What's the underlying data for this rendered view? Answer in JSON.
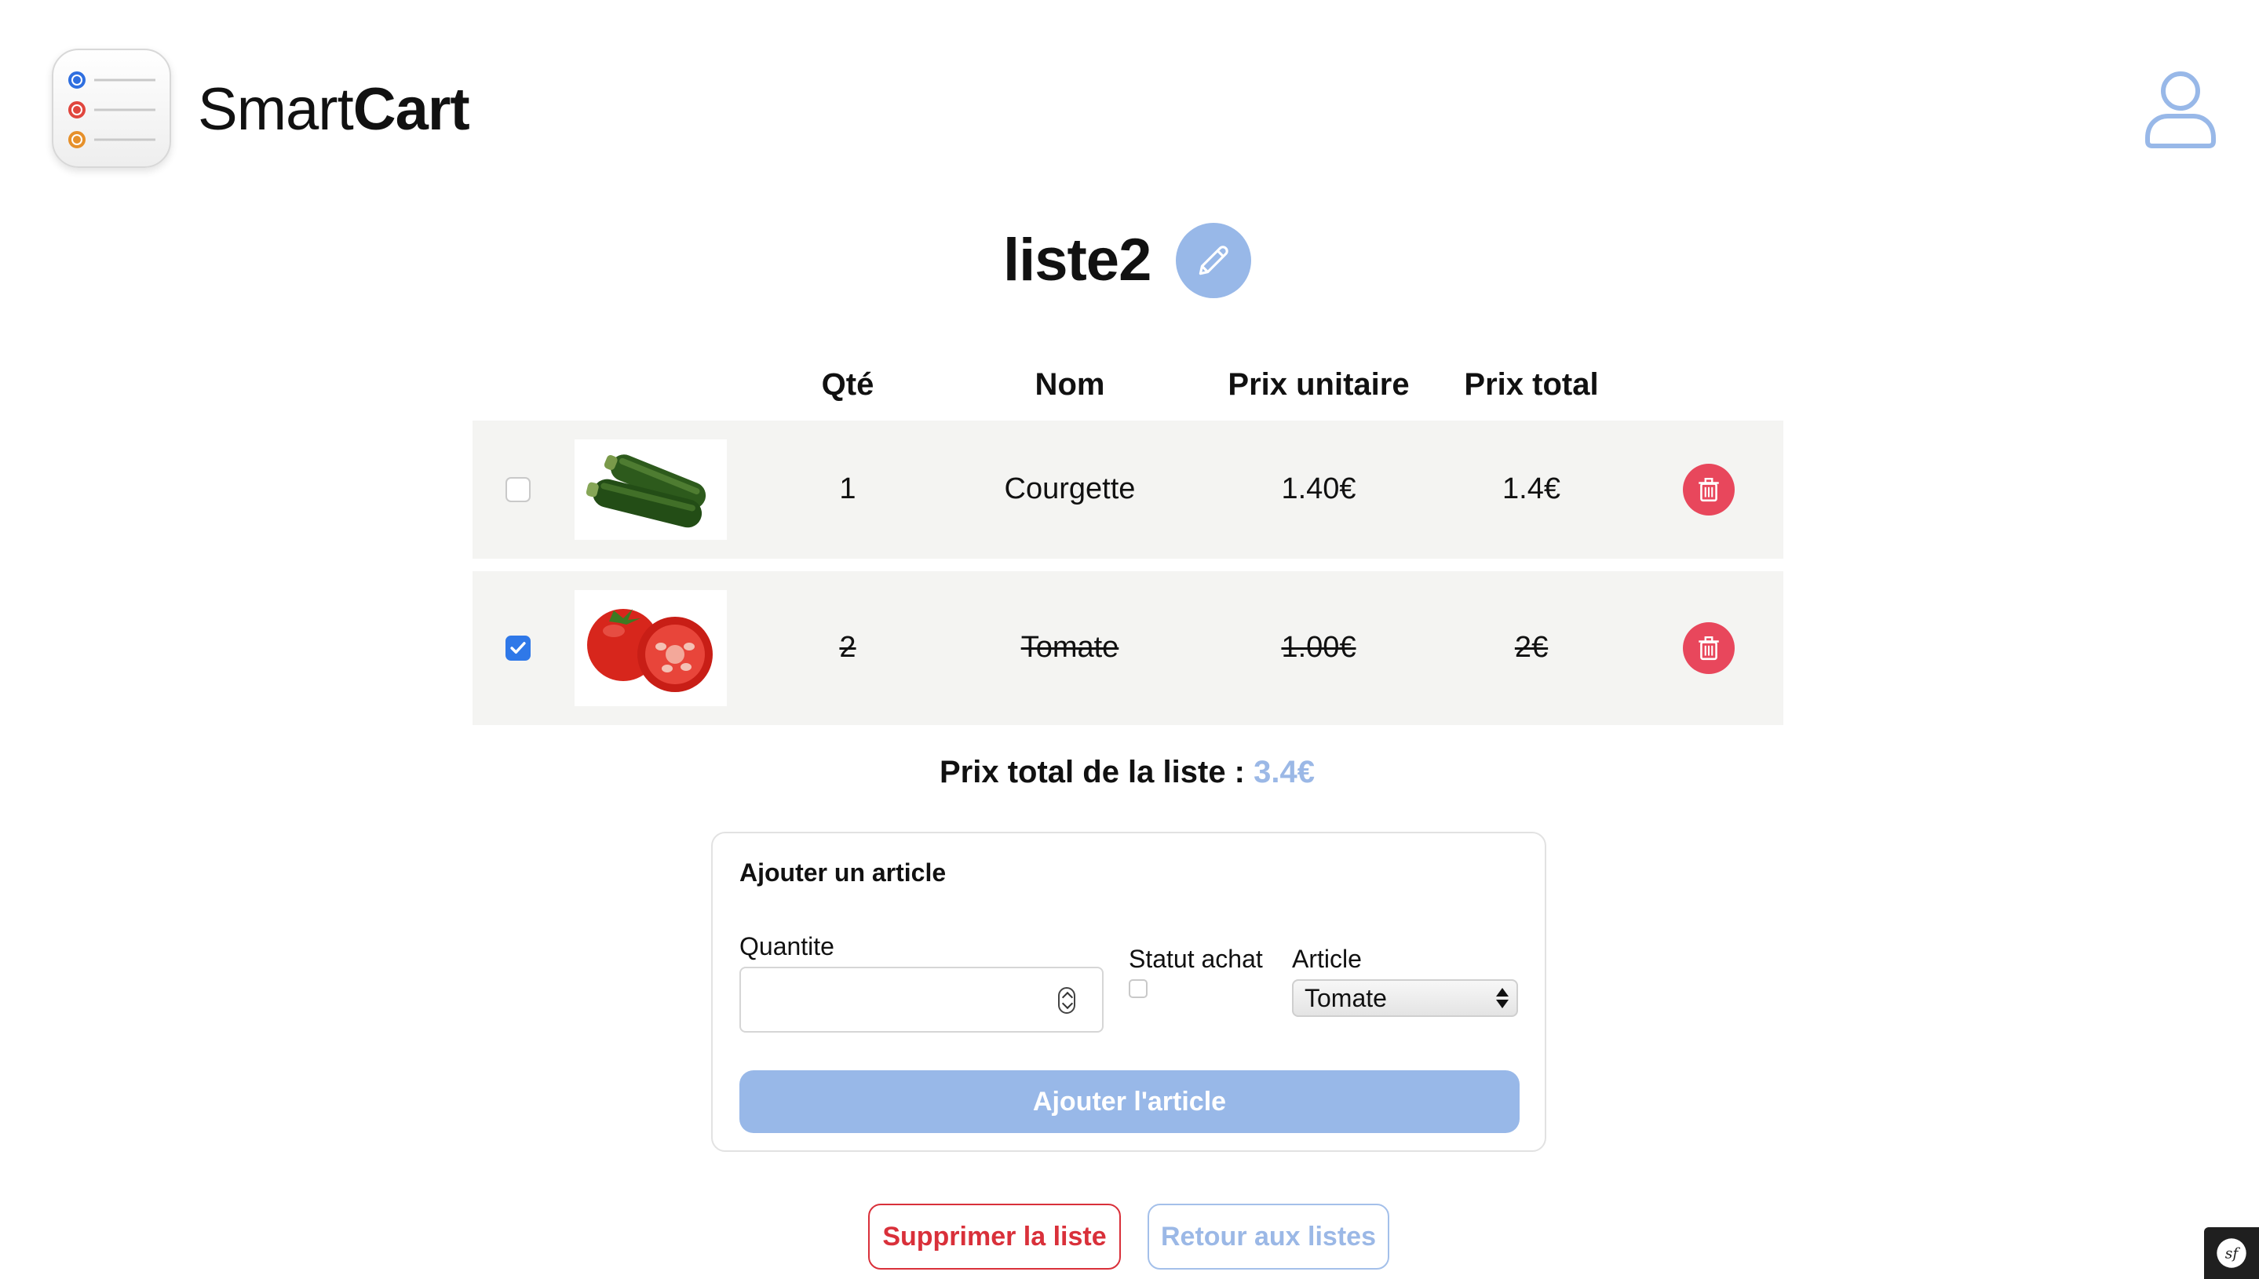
{
  "header": {
    "brand_light": "Smart",
    "brand_bold": "Cart"
  },
  "list": {
    "title": "liste2"
  },
  "table": {
    "columns": [
      "Qté",
      "Nom",
      "Prix unitaire",
      "Prix total"
    ],
    "rows": [
      {
        "checked": false,
        "qty": "1",
        "name": "Courgette",
        "unit_price": "1.40€",
        "total_price": "1.4€",
        "image": "courgette"
      },
      {
        "checked": true,
        "qty": "2",
        "name": "Tomate",
        "unit_price": "1.00€",
        "total_price": "2€",
        "image": "tomate"
      }
    ]
  },
  "summary": {
    "label": "Prix total de la liste :",
    "value": "3.4€"
  },
  "form": {
    "title": "Ajouter un article",
    "qty_label": "Quantite",
    "qty_value": "",
    "status_label": "Statut achat",
    "article_label": "Article",
    "article_selected": "Tomate",
    "submit_label": "Ajouter l'article"
  },
  "actions": {
    "delete_list": "Supprimer la liste",
    "back_to_lists": "Retour aux listes"
  },
  "colors": {
    "accent": "#98b8e8",
    "danger": "#e8475c",
    "checkbox": "#2f78e8"
  },
  "icons": [
    "app-icon",
    "user-icon",
    "pencil-icon",
    "trash-icon",
    "symfony-icon"
  ]
}
